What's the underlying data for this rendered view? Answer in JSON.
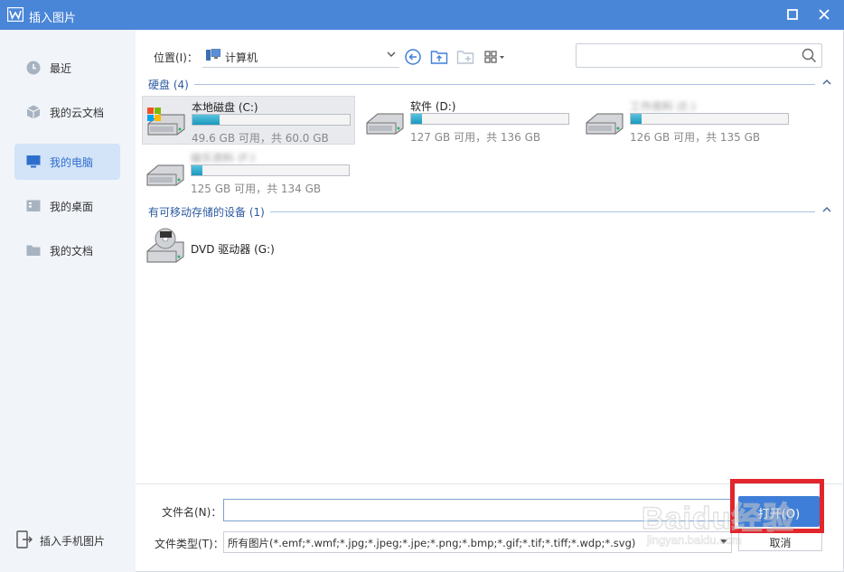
{
  "window": {
    "title": "插入图片",
    "colors": {
      "titlebar": "#4a86d8",
      "accent": "#3f7ed8",
      "section": "#2c5aa0"
    }
  },
  "sidebar": {
    "items": [
      {
        "label": "最近",
        "icon": "clock-icon"
      },
      {
        "label": "我的云文档",
        "icon": "cloud-cube-icon"
      },
      {
        "label": "我的电脑",
        "icon": "monitor-icon",
        "active": true
      },
      {
        "label": "我的桌面",
        "icon": "desktop-icon"
      },
      {
        "label": "我的文档",
        "icon": "folder-icon"
      }
    ],
    "mobile_label": "插入手机图片"
  },
  "toolbar": {
    "location_label": "位置(I)：",
    "location_value": "计算机",
    "search_placeholder": ""
  },
  "sections": {
    "hard_disks": "硬盘 (4)",
    "removable": "有可移动存储的设备 (1)"
  },
  "drives": [
    {
      "name": "本地磁盘 (C:)",
      "info": "49.6 GB 可用，共 60.0 GB",
      "used_fraction": 0.17
    },
    {
      "name": "软件 (D:)",
      "info": "127 GB 可用，共 136 GB",
      "used_fraction": 0.07
    },
    {
      "name": "工作资料 (E:)",
      "info": "126 GB 可用，共 135 GB",
      "used_fraction": 0.07
    },
    {
      "name": "娱乐资料 (F:)",
      "info": "125 GB 可用，共 134 GB",
      "used_fraction": 0.07
    }
  ],
  "dvd": {
    "name": "DVD 驱动器 (G:)"
  },
  "footer": {
    "filename_label": "文件名(N)：",
    "filename_value": "",
    "filetype_label": "文件类型(T)：",
    "filetype_value": "所有图片(*.emf;*.wmf;*.jpg;*.jpeg;*.jpe;*.png;*.bmp;*.gif;*.tif;*.tiff;*.wdp;*.svg)",
    "open_label": "打开(O)",
    "cancel_label": "取消"
  },
  "watermark": {
    "big": "Baidu经验",
    "small": "jingyan.baidu.com"
  }
}
